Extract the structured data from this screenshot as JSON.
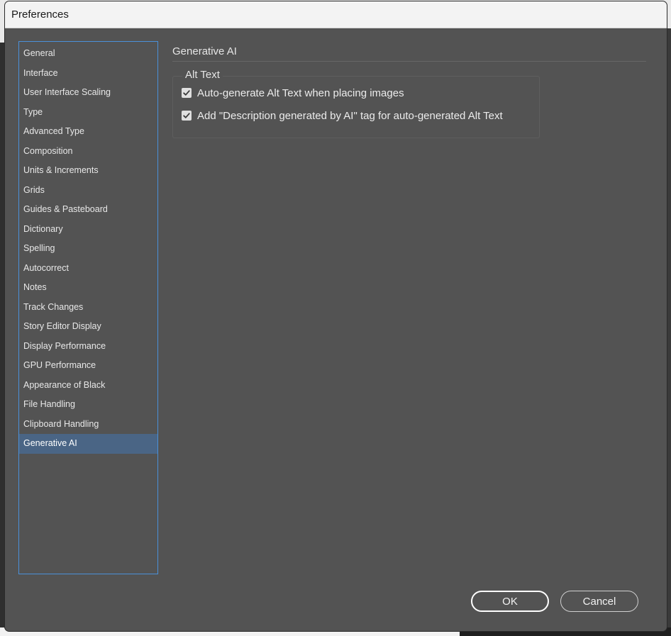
{
  "window": {
    "title": "Preferences"
  },
  "sidebar": {
    "items": [
      {
        "label": "General"
      },
      {
        "label": "Interface"
      },
      {
        "label": "User Interface Scaling"
      },
      {
        "label": "Type"
      },
      {
        "label": "Advanced Type"
      },
      {
        "label": "Composition"
      },
      {
        "label": "Units & Increments"
      },
      {
        "label": "Grids"
      },
      {
        "label": "Guides & Pasteboard"
      },
      {
        "label": "Dictionary"
      },
      {
        "label": "Spelling"
      },
      {
        "label": "Autocorrect"
      },
      {
        "label": "Notes"
      },
      {
        "label": "Track Changes"
      },
      {
        "label": "Story Editor Display"
      },
      {
        "label": "Display Performance"
      },
      {
        "label": "GPU Performance"
      },
      {
        "label": "Appearance of Black"
      },
      {
        "label": "File Handling"
      },
      {
        "label": "Clipboard Handling"
      },
      {
        "label": "Generative AI",
        "selected": true
      }
    ]
  },
  "main": {
    "section_title": "Generative AI",
    "group": {
      "legend": "Alt Text",
      "options": [
        {
          "label": "Auto-generate Alt Text when placing images",
          "checked": true
        },
        {
          "label": "Add \"Description generated by AI\" tag for auto-generated Alt Text",
          "checked": true
        }
      ]
    }
  },
  "buttons": {
    "ok_label": "OK",
    "cancel_label": "Cancel"
  },
  "colors": {
    "selection": "#4a6585",
    "focus_border": "#4a90d9",
    "panel": "#535353"
  }
}
